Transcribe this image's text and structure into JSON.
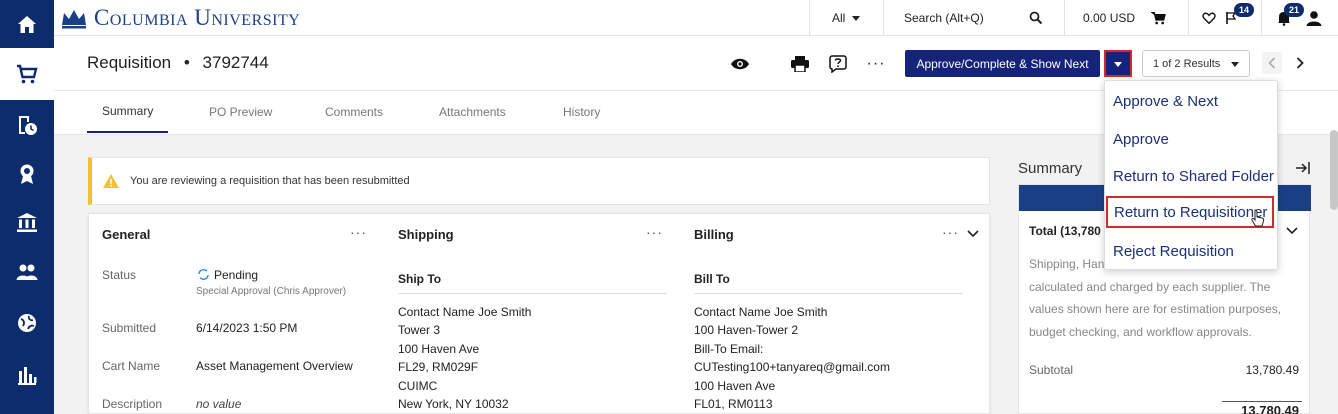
{
  "colors": {
    "nav": "#0d2c6c",
    "primary": "#16237a",
    "highlight": "#d12a2a",
    "warning": "#f1c232"
  },
  "leftnav": {
    "items": [
      {
        "icon": "home-icon"
      },
      {
        "icon": "cart-icon"
      },
      {
        "icon": "clock-document-icon"
      },
      {
        "icon": "award-icon"
      },
      {
        "icon": "bank-icon"
      },
      {
        "icon": "users-icon"
      },
      {
        "icon": "globe-icon"
      },
      {
        "icon": "bar-chart-icon"
      }
    ]
  },
  "topbar": {
    "brand": "Columbia University",
    "filter_label": "All",
    "search_placeholder": "Search (Alt+Q)",
    "cart_total": "0.00 USD",
    "actions_badge": "14",
    "notifications_badge": "21"
  },
  "header": {
    "title": "Requisition",
    "separator": "•",
    "number": "3792744",
    "approve_label": "Approve/Complete & Show Next",
    "results_label": "1 of 2 Results",
    "more_label": "···"
  },
  "tabs": [
    "Summary",
    "PO Preview",
    "Comments",
    "Attachments",
    "History"
  ],
  "alert": {
    "text": "You are reviewing a requisition that has been resubmitted"
  },
  "general": {
    "title": "General",
    "status_label": "Status",
    "status_value": "Pending",
    "status_detail": "Special Approval (Chris Approver)",
    "submitted_label": "Submitted",
    "submitted_value": "6/14/2023 1:50 PM",
    "cart_name_label": "Cart Name",
    "cart_name_value": "Asset Management Overview",
    "description_label": "Description",
    "description_value": "no value"
  },
  "shipping": {
    "title": "Shipping",
    "ship_to_label": "Ship To",
    "lines": [
      "Contact Name Joe Smith",
      "Tower 3",
      "100 Haven Ave",
      "FL29, RM029F",
      "CUIMC",
      "New York, NY 10032"
    ]
  },
  "billing": {
    "title": "Billing",
    "bill_to_label": "Bill To",
    "lines": [
      "Contact Name Joe Smith",
      "100 Haven-Tower 2",
      "Bill-To Email:",
      "CUTesting100+tanyareq@gmail.com",
      "100 Haven Ave",
      "FL01, RM0113"
    ]
  },
  "summary": {
    "title": "Summary",
    "total_label": "Total (13,780",
    "note_lines": [
      "Shipping, Han",
      "calculated and charged by each supplier. The",
      "values shown here are for estimation purposes,",
      "budget checking, and workflow approvals."
    ],
    "subtotal_label": "Subtotal",
    "subtotal_value": "13,780.49",
    "total_value": "13,780.49"
  },
  "menu": {
    "items": [
      "Approve & Next",
      "Approve",
      "Return to Shared Folder",
      "Return to Requisitioner",
      "Reject Requisition"
    ]
  }
}
